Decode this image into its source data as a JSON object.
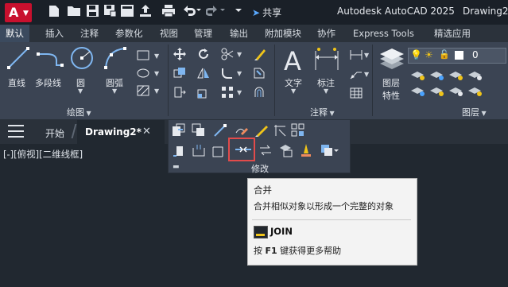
{
  "titlebar": {
    "app_logo_letter": "A",
    "share_label": "共享",
    "app_title": "Autodesk AutoCAD 2025",
    "doc_title": "Drawing2."
  },
  "ribbon_tabs": [
    "默认",
    "插入",
    "注释",
    "参数化",
    "视图",
    "管理",
    "输出",
    "附加模块",
    "协作",
    "Express Tools",
    "精选应用"
  ],
  "ribbon": {
    "draw": {
      "line": "直线",
      "polyline": "多段线",
      "circle": "圆",
      "arc": "圆弧",
      "panel_title": "绘图"
    },
    "annotation": {
      "text": "文字",
      "dimension": "标注",
      "panel_title": "注释"
    },
    "layers": {
      "layer_props_line1": "图层",
      "layer_props_line2": "特性",
      "current_layer": "0",
      "panel_title": "图层"
    }
  },
  "file_tabs": {
    "start": "开始",
    "drawing": "Drawing2*"
  },
  "viewport_label": "[-][俯视][二维线框]",
  "modify_panel": {
    "title": "修改"
  },
  "tooltip": {
    "title": "合并",
    "description": "合并相似对象以形成一个完整的对象",
    "command": "JOIN",
    "help_prefix": "按",
    "help_key": "F1",
    "help_suffix": "键获得更多帮助"
  },
  "colors": {
    "accent_red": "#e24b4b",
    "logo_red": "#c8102e",
    "active_tab": "#3b4a5e",
    "ribbon_bg": "#3b4453",
    "canvas_bg": "#212830"
  }
}
